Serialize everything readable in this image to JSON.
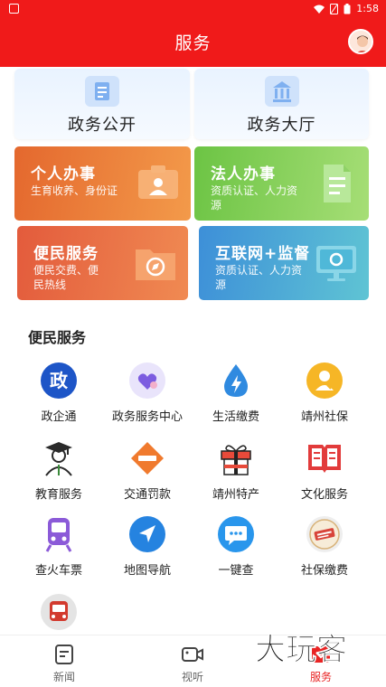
{
  "status": {
    "time": "1:58"
  },
  "header": {
    "title": "服务"
  },
  "quick_cards": [
    {
      "label": "政务公开"
    },
    {
      "label": "政务大厅"
    }
  ],
  "feature_cards": [
    {
      "title": "个人办事",
      "subtitle": "生育收养、身份证",
      "color": "#e8702c"
    },
    {
      "title": "法人办事",
      "subtitle": "资质认证、人力资源",
      "color": "#7ccf55"
    },
    {
      "title": "便民服务",
      "subtitle": "便民交费、便民热线",
      "color": "#e66a3c"
    },
    {
      "title": "互联网+监督",
      "subtitle": "资质认证、人力资源",
      "color": "#3aa0d6"
    }
  ],
  "section": {
    "title": "便民服务"
  },
  "services": [
    {
      "label": "政企通",
      "icon": "zheng-badge-icon"
    },
    {
      "label": "政务服务中心",
      "icon": "heart-hands-icon"
    },
    {
      "label": "生活缴费",
      "icon": "lightning-drop-icon"
    },
    {
      "label": "靖州社保",
      "icon": "social-security-icon"
    },
    {
      "label": "教育服务",
      "icon": "graduate-icon"
    },
    {
      "label": "交通罚款",
      "icon": "no-entry-icon"
    },
    {
      "label": "靖州特产",
      "icon": "gift-box-icon"
    },
    {
      "label": "文化服务",
      "icon": "book-icon"
    },
    {
      "label": "查火车票",
      "icon": "train-icon"
    },
    {
      "label": "地图导航",
      "icon": "navigation-arrow-icon"
    },
    {
      "label": "一键查",
      "icon": "chat-bubble-icon"
    },
    {
      "label": "社保缴费",
      "icon": "stamp-icon"
    },
    {
      "label": "",
      "icon": "bus-icon"
    }
  ],
  "tabs": [
    {
      "label": "新闻",
      "icon": "news-icon",
      "active": false
    },
    {
      "label": "视听",
      "icon": "video-icon",
      "active": false
    },
    {
      "label": "服务",
      "icon": "service-icon",
      "active": true
    }
  ],
  "watermark": {
    "text": "大玩客"
  },
  "colors": {
    "brand_red": "#f01a1a",
    "active_tab": "#e82424"
  }
}
